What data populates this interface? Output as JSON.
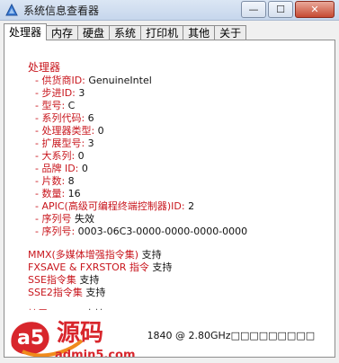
{
  "window": {
    "title": "系统信息查看器",
    "controls": {
      "minimize": "—",
      "maximize": "☐",
      "close": "✕"
    }
  },
  "tabs": [
    {
      "label": "处理器",
      "active": true
    },
    {
      "label": "内存",
      "active": false
    },
    {
      "label": "硬盘",
      "active": false
    },
    {
      "label": "系统",
      "active": false
    },
    {
      "label": "打印机",
      "active": false
    },
    {
      "label": "其他",
      "active": false
    },
    {
      "label": "关于",
      "active": false
    }
  ],
  "processor": {
    "heading": "处理器",
    "fields": [
      {
        "label": "- 供货商ID:",
        "value": "GenuineIntel"
      },
      {
        "label": "- 步进ID:",
        "value": "3"
      },
      {
        "label": "- 型号:",
        "value": "C"
      },
      {
        "label": "- 系列代码:",
        "value": "6"
      },
      {
        "label": "- 处理器类型:",
        "value": "0"
      },
      {
        "label": "- 扩展型号:",
        "value": "3"
      },
      {
        "label": "- 大系列:",
        "value": "0"
      },
      {
        "label": "- 品牌 ID:",
        "value": "0"
      },
      {
        "label": "- 片数:",
        "value": "8"
      },
      {
        "label": "- 数量:",
        "value": "16"
      },
      {
        "label": "- APIC(高级可编程终端控制器)ID:",
        "value": "2"
      },
      {
        "label": "- 序列号",
        "value": "失效"
      },
      {
        "label": "- 序列号:",
        "value": "0003-06C3-0000-0000-0000-0000"
      }
    ],
    "features": [
      {
        "label": "MMX(多媒体增强指令集)",
        "value": "支持"
      },
      {
        "label": "FXSAVE & FXRSTOR 指令",
        "value": "支持"
      },
      {
        "label": "SSE指令集",
        "value": "支持"
      },
      {
        "label": "SSE2指令集",
        "value": "支持"
      }
    ],
    "extended": {
      "label": "扩展CPUID:",
      "value": "支持"
    },
    "cpu_name": "G1840 @ 2.80GHz□□□□□□□□□"
  },
  "watermark": {
    "brand": "源码",
    "site": "admin5.com",
    "logo_letter": "a5"
  },
  "colors": {
    "label_red": "#c8161d",
    "value_black": "#111111",
    "watermark_red": "#d8262c",
    "watermark_orange": "#f08a1c"
  }
}
